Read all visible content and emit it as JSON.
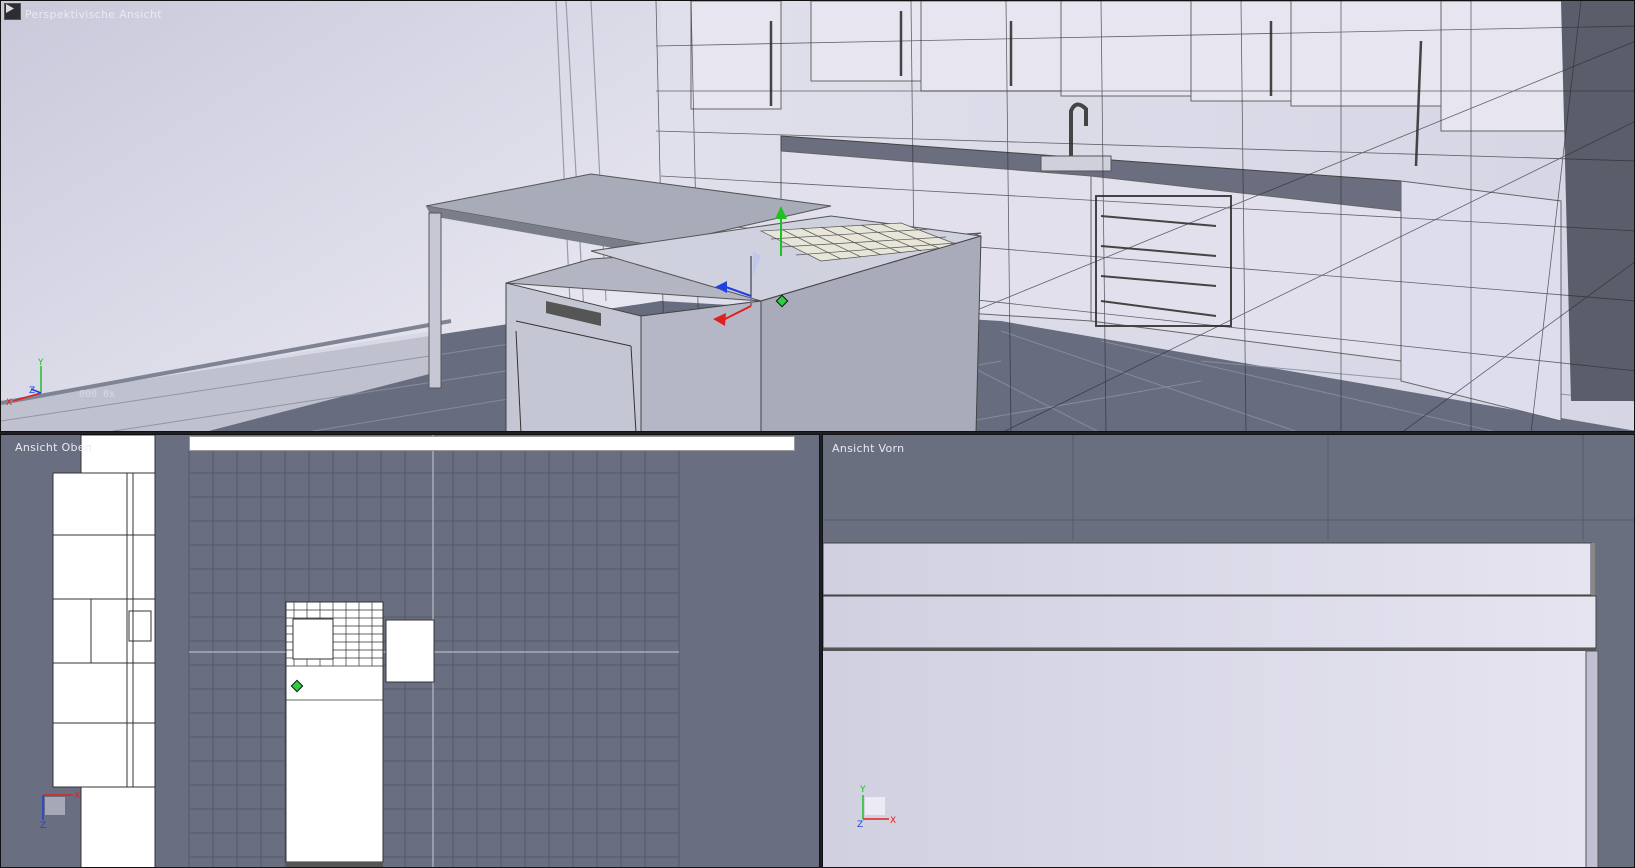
{
  "viewports": {
    "perspective": {
      "label": "Perspektivische Ansicht",
      "coord_readout": "000 0x"
    },
    "top": {
      "label": "Ansicht Oben"
    },
    "front": {
      "label": "Ansicht Vorn"
    }
  },
  "axis": {
    "x": "X",
    "y": "Y",
    "z": "Z"
  },
  "icons": {
    "play": "play-icon",
    "gizmo": "transform-gizmo-icon",
    "axis": "axis-triad-icon"
  },
  "colors": {
    "axis_x": "#e02020",
    "axis_y": "#20c020",
    "axis_z": "#2040e0",
    "handle": "#2ecc40"
  }
}
